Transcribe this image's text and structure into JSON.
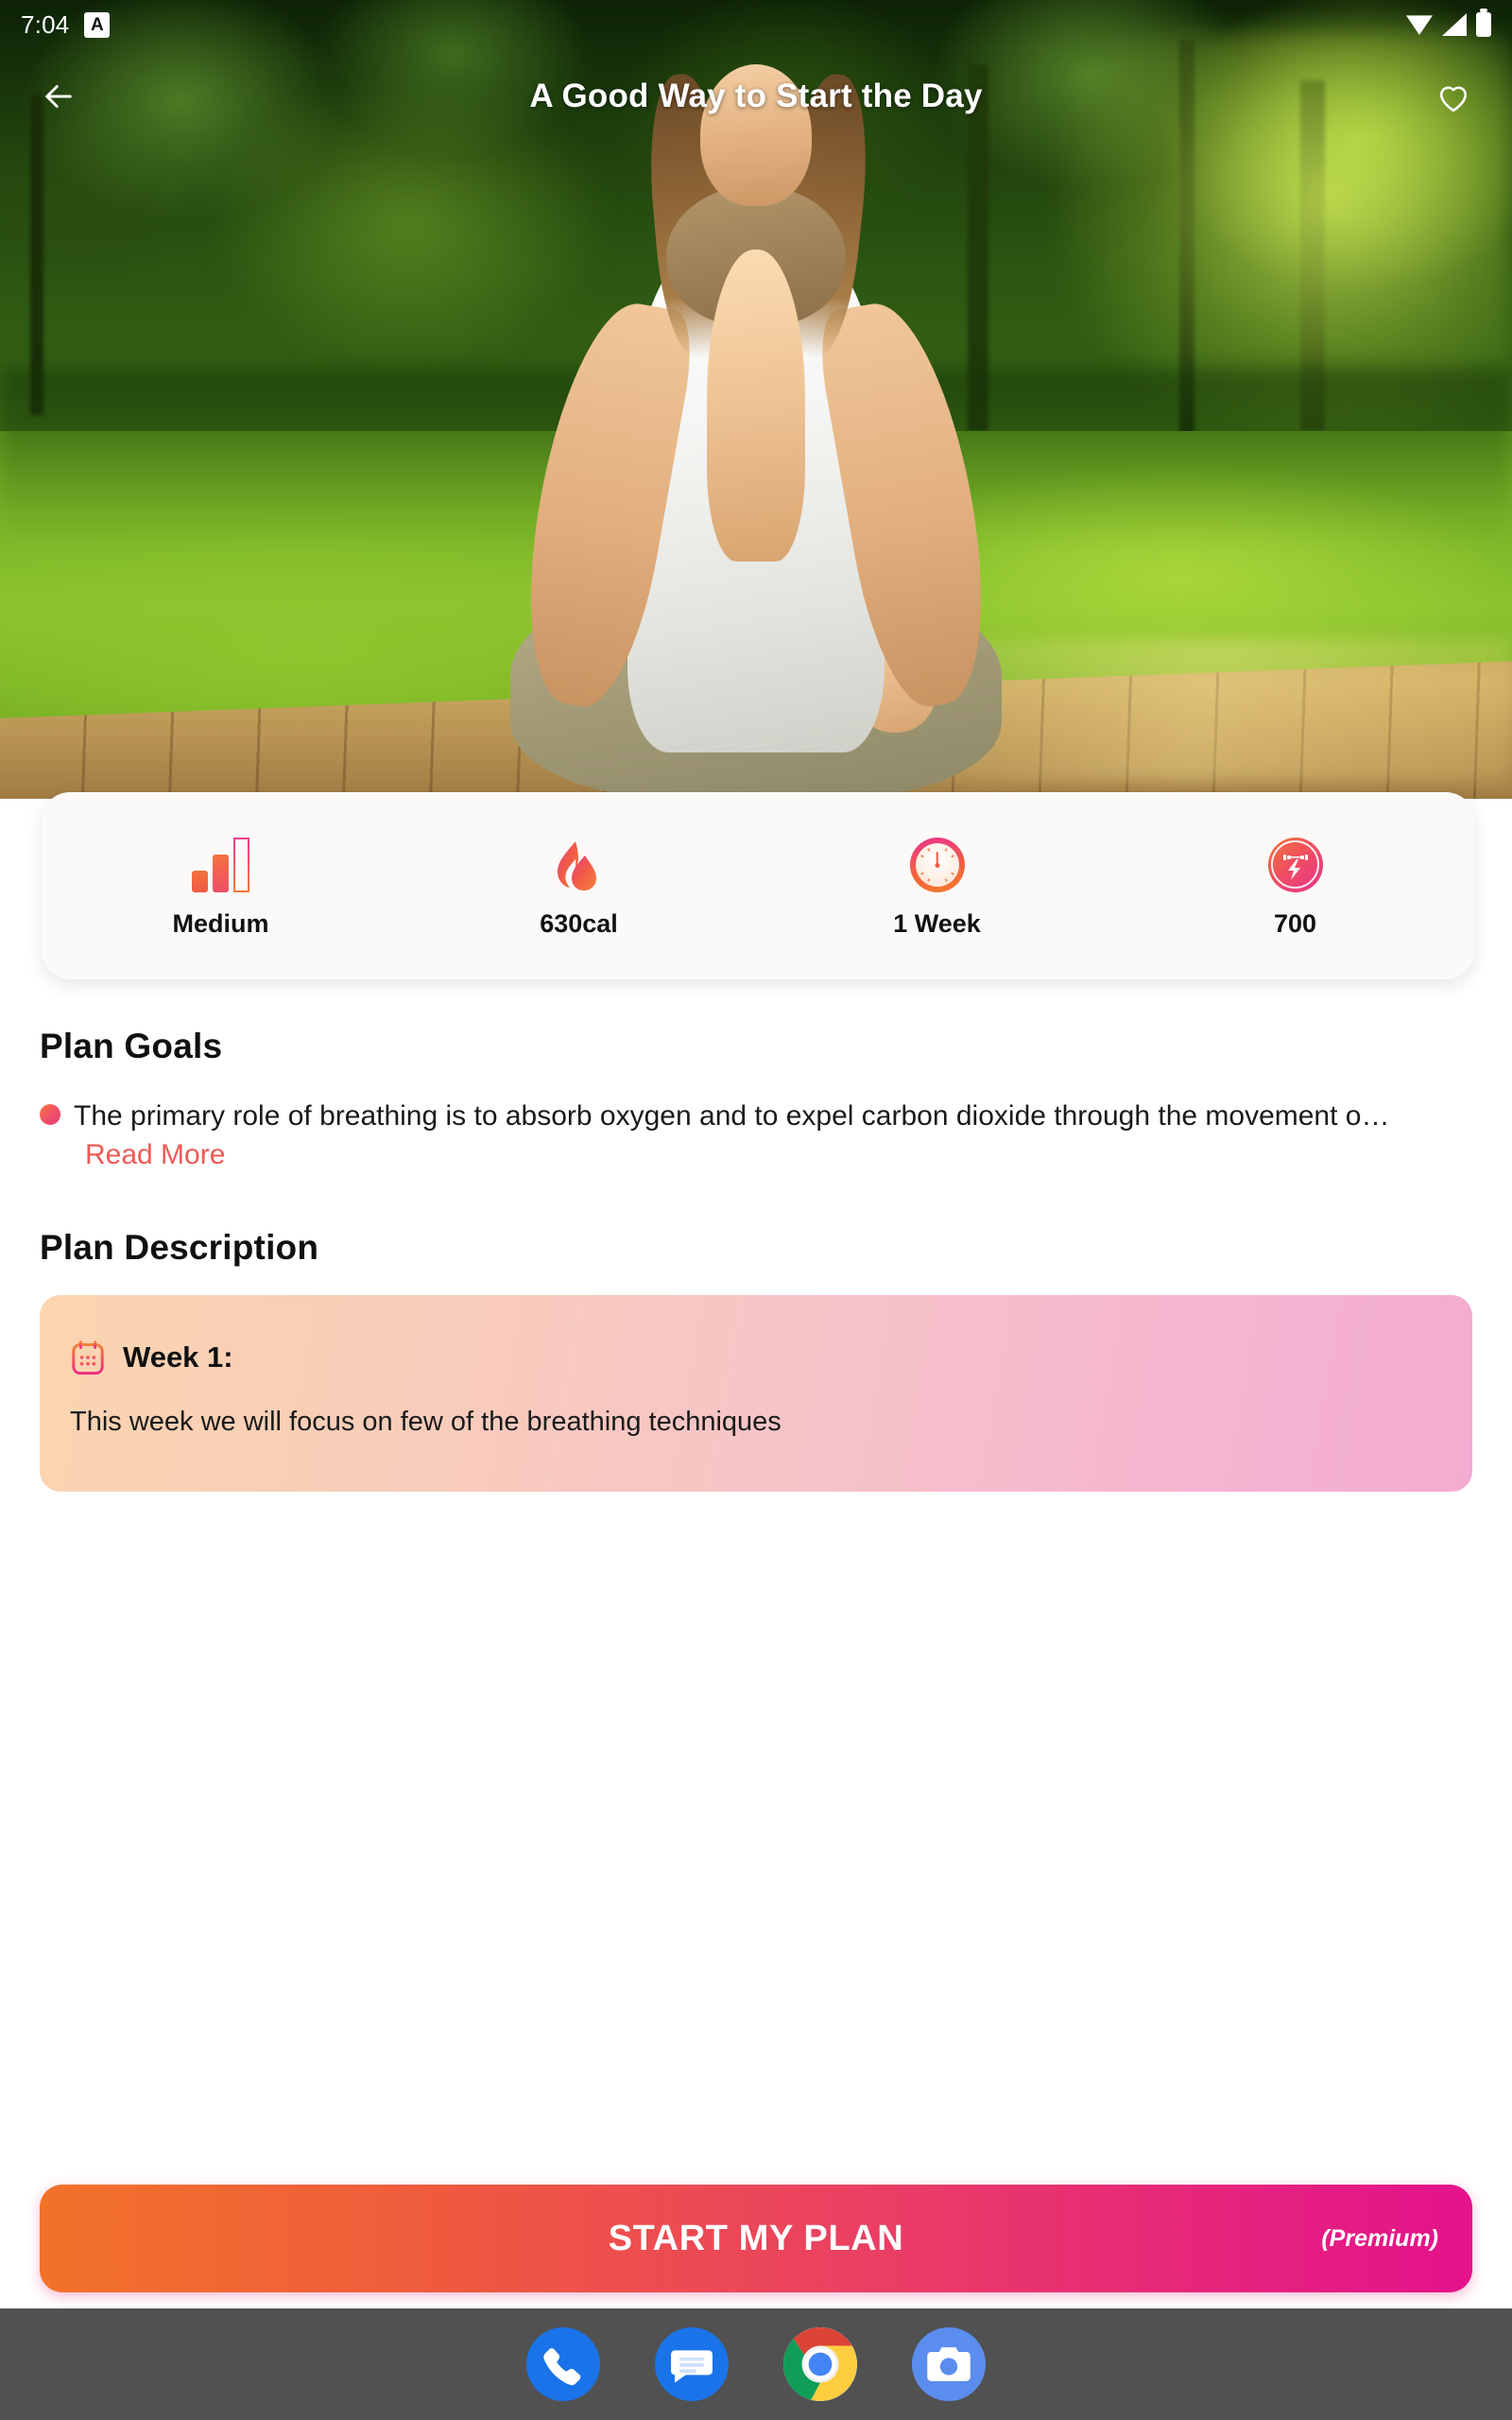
{
  "status_bar": {
    "time": "7:04",
    "badge_label": "A",
    "icons": [
      "wifi-icon",
      "signal-icon",
      "battery-icon"
    ]
  },
  "app_bar": {
    "title": "A Good Way to Start the Day",
    "back_icon": "back-arrow-icon",
    "favorite_icon": "heart-outline-icon"
  },
  "hero": {
    "alt": "Woman meditating in lotus pose on a wooden deck in a sunlit park"
  },
  "stats": [
    {
      "icon": "difficulty-bars-icon",
      "label": "Medium"
    },
    {
      "icon": "flame-icon",
      "label": "630cal"
    },
    {
      "icon": "clock-icon",
      "label": "1 Week"
    },
    {
      "icon": "points-bolt-icon",
      "label": "700"
    }
  ],
  "plan_goals": {
    "heading": "Plan Goals",
    "bullet_text": "The primary role of breathing is to absorb oxygen and to expel carbon dioxide through the movement o…",
    "read_more_label": "Read More"
  },
  "plan_description": {
    "heading": "Plan Description",
    "week_icon": "calendar-icon",
    "week_title": "Week 1:",
    "week_body": "This week we will focus on few of the breathing techniques"
  },
  "cta": {
    "label": "START MY PLAN",
    "premium_label": "(Premium)"
  },
  "dock": {
    "apps": [
      {
        "name": "phone-app-icon"
      },
      {
        "name": "messages-app-icon"
      },
      {
        "name": "chrome-app-icon"
      },
      {
        "name": "camera-app-icon"
      }
    ]
  },
  "colors": {
    "accent_orange": "#f4763a",
    "accent_pink": "#e8338f",
    "read_more": "#ef5a55",
    "card_bg": "#fbfaf8",
    "dock_bg": "#515151"
  }
}
